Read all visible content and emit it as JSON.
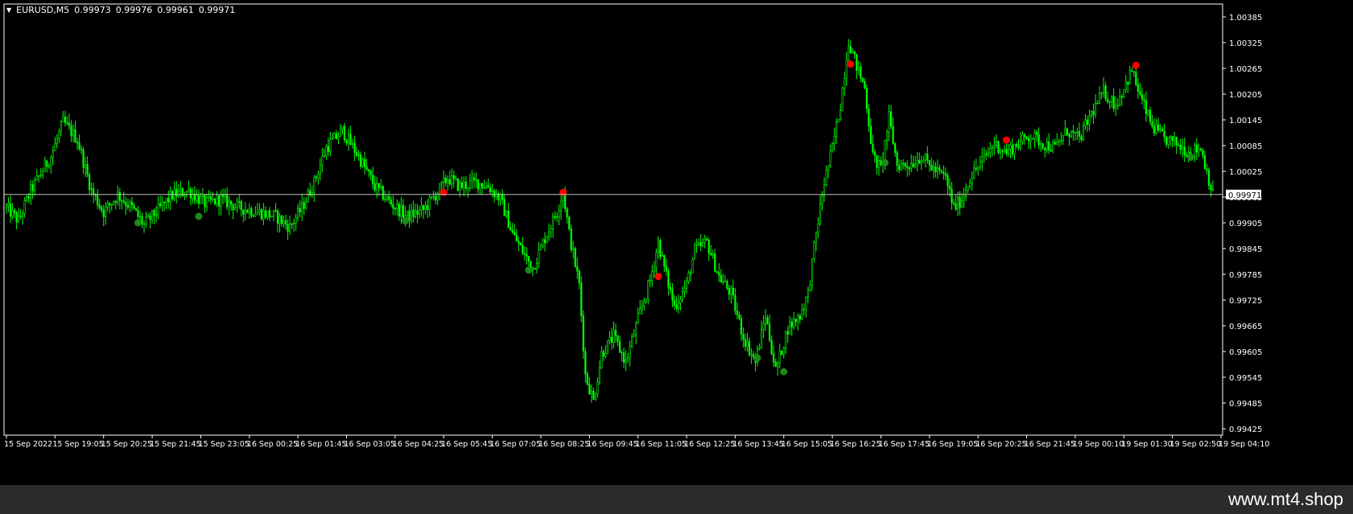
{
  "header": {
    "symbol": "EURUSD,M5",
    "open": "0.99973",
    "high": "0.99976",
    "low": "0.99961",
    "close": "0.99971"
  },
  "watermark": "www.mt4.shop",
  "colors": {
    "background": "#000000",
    "candle": "#00ff00",
    "buy_signal": "#1a8a1a",
    "sell_signal": "#ff0000",
    "axis": "#ffffff",
    "current_price_line": "#c0c0c0"
  },
  "chart_data": {
    "type": "candlestick",
    "symbol": "EURUSD",
    "timeframe": "M5",
    "ylim": [
      0.9941,
      1.00415
    ],
    "y_ticks": [
      "1.00385",
      "1.00325",
      "1.00265",
      "1.00205",
      "1.00145",
      "1.00085",
      "1.00025",
      "0.99965",
      "0.99905",
      "0.99845",
      "0.99785",
      "0.99725",
      "0.99665",
      "0.99605",
      "0.99545",
      "0.99485",
      "0.99425"
    ],
    "current_price": 0.99971,
    "current_price_label": "0.99971",
    "x_labels": [
      "15 Sep 2022",
      "15 Sep 19:05",
      "15 Sep 20:25",
      "15 Sep 21:45",
      "15 Sep 23:05",
      "16 Sep 00:25",
      "16 Sep 01:45",
      "16 Sep 03:05",
      "16 Sep 04:25",
      "16 Sep 05:45",
      "16 Sep 07:05",
      "16 Sep 08:25",
      "16 Sep 09:45",
      "16 Sep 11:05",
      "16 Sep 12:25",
      "16 Sep 13:45",
      "16 Sep 15:05",
      "16 Sep 16:25",
      "16 Sep 17:45",
      "16 Sep 19:05",
      "16 Sep 20:25",
      "16 Sep 21:45",
      "19 Sep 00:10",
      "19 Sep 01:30",
      "19 Sep 02:50",
      "19 Sep 04:10"
    ],
    "bars_per_label": 16,
    "grid": false,
    "price_path": [
      [
        0,
        0.9994
      ],
      [
        6,
        0.9991
      ],
      [
        12,
        0.9998
      ],
      [
        22,
        1.0006
      ],
      [
        28,
        1.0014
      ],
      [
        35,
        1.001
      ],
      [
        42,
        0.9998
      ],
      [
        48,
        0.9993
      ],
      [
        55,
        0.9997
      ],
      [
        62,
        0.9994
      ],
      [
        68,
        0.999
      ],
      [
        75,
        0.99935
      ],
      [
        82,
        0.9997
      ],
      [
        90,
        0.9998
      ],
      [
        98,
        0.9995
      ],
      [
        106,
        0.9996
      ],
      [
        115,
        0.9994
      ],
      [
        125,
        0.9993
      ],
      [
        133,
        0.9992
      ],
      [
        140,
        0.99895
      ],
      [
        146,
        0.9994
      ],
      [
        152,
        1.0
      ],
      [
        158,
        1.0008
      ],
      [
        166,
        1.0012
      ],
      [
        174,
        1.0006
      ],
      [
        182,
        0.9999
      ],
      [
        190,
        0.9995
      ],
      [
        198,
        0.9992
      ],
      [
        206,
        0.99935
      ],
      [
        212,
        0.9997
      ],
      [
        218,
        1.0001
      ],
      [
        224,
        0.9999
      ],
      [
        232,
        1.0
      ],
      [
        238,
        0.9999
      ],
      [
        244,
        0.9996
      ],
      [
        250,
        0.9988
      ],
      [
        256,
        0.9983
      ],
      [
        260,
        0.998
      ],
      [
        266,
        0.9987
      ],
      [
        272,
        0.9993
      ],
      [
        275,
        0.9998
      ],
      [
        278,
        0.9988
      ],
      [
        283,
        0.9976
      ],
      [
        286,
        0.9955
      ],
      [
        290,
        0.9949
      ],
      [
        294,
        0.996
      ],
      [
        300,
        0.9964
      ],
      [
        306,
        0.9958
      ],
      [
        312,
        0.9968
      ],
      [
        318,
        0.9977
      ],
      [
        322,
        0.9986
      ],
      [
        326,
        0.9978
      ],
      [
        330,
        0.9971
      ],
      [
        336,
        0.9976
      ],
      [
        340,
        0.9984
      ],
      [
        346,
        0.9986
      ],
      [
        352,
        0.9978
      ],
      [
        358,
        0.9974
      ],
      [
        364,
        0.9964
      ],
      [
        370,
        0.9958
      ],
      [
        375,
        0.9969
      ],
      [
        380,
        0.9956
      ],
      [
        386,
        0.9966
      ],
      [
        392,
        0.9969
      ],
      [
        396,
        0.9974
      ],
      [
        400,
        0.9988
      ],
      [
        404,
        1.0
      ],
      [
        408,
        1.0008
      ],
      [
        412,
        1.0018
      ],
      [
        416,
        1.0033
      ],
      [
        420,
        1.0027
      ],
      [
        424,
        1.0022
      ],
      [
        428,
        1.0006
      ],
      [
        432,
        1.0003
      ],
      [
        436,
        1.0015
      ],
      [
        440,
        1.0004
      ],
      [
        446,
        1.0004
      ],
      [
        452,
        1.0006
      ],
      [
        458,
        1.0003
      ],
      [
        464,
        1.0001
      ],
      [
        468,
        0.9994
      ],
      [
        472,
        0.9996
      ],
      [
        476,
        1.0001
      ],
      [
        482,
        1.0005
      ],
      [
        488,
        1.0009
      ],
      [
        494,
        1.0007
      ],
      [
        500,
        1.0009
      ],
      [
        506,
        1.0011
      ],
      [
        512,
        1.0009
      ],
      [
        518,
        1.0008
      ],
      [
        524,
        1.0012
      ],
      [
        530,
        1.001
      ],
      [
        536,
        1.0016
      ],
      [
        542,
        1.0021
      ],
      [
        548,
        1.0018
      ],
      [
        552,
        1.0022
      ],
      [
        556,
        1.0026
      ],
      [
        560,
        1.002
      ],
      [
        566,
        1.0013
      ],
      [
        572,
        1.001
      ],
      [
        578,
        1.0009
      ],
      [
        584,
        1.0007
      ],
      [
        590,
        1.0008
      ],
      [
        596,
        0.9997
      ]
    ],
    "sell_signals": [
      {
        "bar": 216,
        "price": 0.99976
      },
      {
        "bar": 275,
        "price": 0.99976
      },
      {
        "bar": 322,
        "price": 0.9978
      },
      {
        "bar": 417,
        "price": 1.00275
      },
      {
        "bar": 494,
        "price": 1.00098
      },
      {
        "bar": 558,
        "price": 1.00272
      }
    ],
    "buy_signals": [
      {
        "bar": 65,
        "price": 0.99905
      },
      {
        "bar": 95,
        "price": 0.9992
      },
      {
        "bar": 197,
        "price": 0.9991
      },
      {
        "bar": 258,
        "price": 0.99795
      },
      {
        "bar": 371,
        "price": 0.9959
      },
      {
        "bar": 384,
        "price": 0.99558
      },
      {
        "bar": 434,
        "price": 1.00045
      },
      {
        "bar": 585,
        "price": 1.00058
      }
    ],
    "bar_count": 597
  }
}
